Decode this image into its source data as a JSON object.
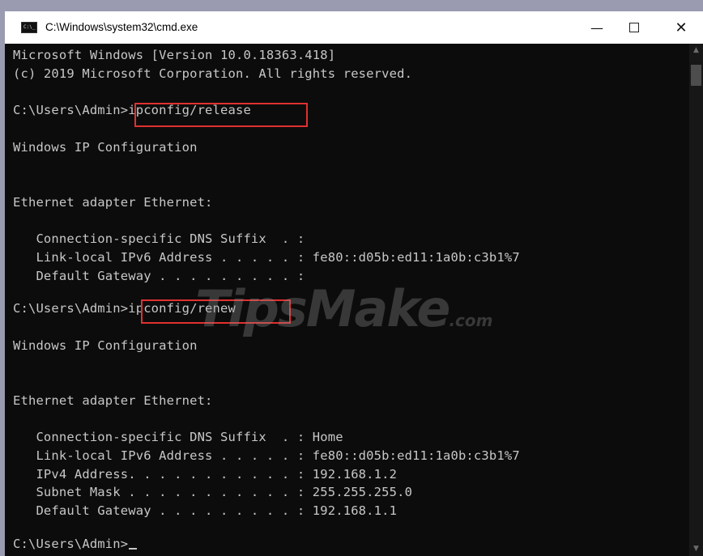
{
  "window": {
    "title": "C:\\Windows\\system32\\cmd.exe",
    "minimize_glyph": "—",
    "close_glyph": "✕"
  },
  "console": {
    "lines": [
      "Microsoft Windows [Version 10.0.18363.418]",
      "(c) 2019 Microsoft Corporation. All rights reserved.",
      "",
      "C:\\Users\\Admin>ipconfig/release",
      "",
      "Windows IP Configuration",
      "",
      "",
      "Ethernet adapter Ethernet:",
      "",
      "   Connection-specific DNS Suffix  . :",
      "   Link-local IPv6 Address . . . . . : fe80::d05b:ed11:1a0b:c3b1%7",
      "   Default Gateway . . . . . . . . . :",
      "",
      "C:\\Users\\Admin>ipconfig/renew",
      "",
      "Windows IP Configuration",
      "",
      "",
      "Ethernet adapter Ethernet:",
      "",
      "   Connection-specific DNS Suffix  . : Home",
      "   Link-local IPv6 Address . . . . . : fe80::d05b:ed11:1a0b:c3b1%7",
      "   IPv4 Address. . . . . . . . . . . : 192.168.1.2",
      "   Subnet Mask . . . . . . . . . . . : 255.255.255.0",
      "   Default Gateway . . . . . . . . . : 192.168.1.1",
      "",
      "C:\\Users\\Admin>"
    ]
  },
  "watermark": {
    "brand": "TipsMake",
    "suffix": ".com"
  },
  "scrollbar": {
    "up_glyph": "▲",
    "down_glyph": "▼"
  },
  "colors": {
    "console_bg": "#0c0c0c",
    "console_text": "#c7c7c7",
    "highlight": "#e03030"
  }
}
